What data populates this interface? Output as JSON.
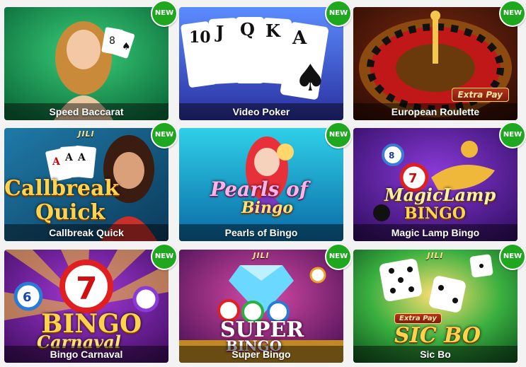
{
  "badge_text": "NEW",
  "games": [
    {
      "title": "Speed Baccarat"
    },
    {
      "title": "Video Poker"
    },
    {
      "title": "European Roulette",
      "ribbon": "Extra Pay"
    },
    {
      "title": "Callbreak Quick",
      "provider": "JILI",
      "logo_top": "Callbreak",
      "logo_bottom": "Quick"
    },
    {
      "title": "Pearls of Bingo",
      "logo_top": "Pearls of",
      "logo_bottom": "Bingo"
    },
    {
      "title": "Magic Lamp Bingo",
      "logo_top": "MagicLamp",
      "logo_bottom": "BINGO"
    },
    {
      "title": "Bingo Carnaval",
      "logo_top": "BINGO",
      "logo_bottom": "Carnaval"
    },
    {
      "title": "Super Bingo",
      "provider": "JILI",
      "logo_top": "SUPER",
      "logo_bottom": "BINGO"
    },
    {
      "title": "Sic Bo",
      "provider": "JILI",
      "ribbon": "Extra Pay",
      "logo_top": "SIC BO"
    }
  ],
  "colors": {
    "badge": "#1fa81f",
    "caption_overlay": "rgba(0,0,0,0.45)"
  },
  "card_images": [
    "baccarat dealer with cards",
    "royal flush spade cards",
    "roulette wheel",
    "indian woman with cards",
    "mermaid with pearls",
    "magic lamp with bingo balls",
    "bingo balls carnival",
    "diamond with bingo balls",
    "white dice"
  ]
}
